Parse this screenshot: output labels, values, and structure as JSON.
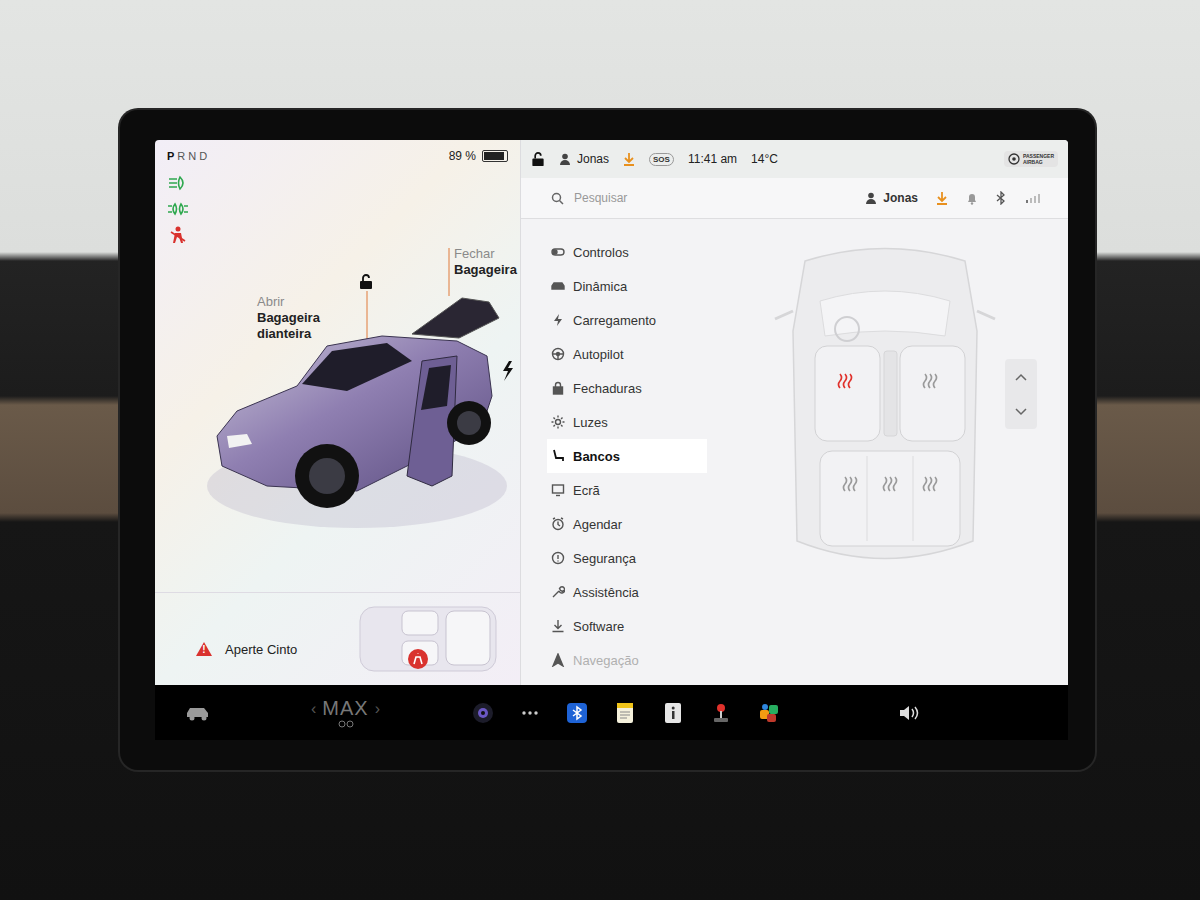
{
  "drive_state": {
    "gears": [
      {
        "label": "P",
        "selected": true
      },
      {
        "label": "R",
        "selected": false
      },
      {
        "label": "N",
        "selected": false
      },
      {
        "label": "D",
        "selected": false
      }
    ],
    "battery": {
      "reading": "89 %",
      "level": 0.89
    }
  },
  "indicators": [
    {
      "kind": "headlight",
      "color": "#2fa84f"
    },
    {
      "kind": "parklight",
      "color": "#2fa84f"
    },
    {
      "kind": "seatbelt",
      "color": "#d9322e"
    }
  ],
  "trunk_controls": [
    {
      "action": "Abrir",
      "target": "Bagageira dianteira",
      "locked": false
    },
    {
      "action": "Fechar",
      "target": "Bagageira"
    }
  ],
  "alert": {
    "icon": "!",
    "text": "Aperte Cinto"
  },
  "status_bar": {
    "locked": false,
    "user": "Jonas",
    "sos": "SOS",
    "time": "11:41 am",
    "temperature": "14°C",
    "badge": {
      "line1": "PASSENGER",
      "line2": "AIRBAG"
    }
  },
  "search": {
    "placeholder": "Pesquisar"
  },
  "profile": {
    "user": "Jonas"
  },
  "menu": [
    {
      "label": "Controlos",
      "kind": "toggle",
      "selected": false
    },
    {
      "label": "Dinâmica",
      "kind": "car",
      "selected": false
    },
    {
      "label": "Carregamento",
      "kind": "bolt",
      "selected": false
    },
    {
      "label": "Autopilot",
      "kind": "wheel",
      "selected": false
    },
    {
      "label": "Fechaduras",
      "kind": "lock",
      "selected": false
    },
    {
      "label": "Luzes",
      "kind": "sun",
      "selected": false
    },
    {
      "label": "Bancos",
      "kind": "seat",
      "selected": true
    },
    {
      "label": "Ecrã",
      "kind": "screen",
      "selected": false
    },
    {
      "label": "Agendar",
      "kind": "clock",
      "selected": false
    },
    {
      "label": "Segurança",
      "kind": "shield",
      "selected": false
    },
    {
      "label": "Assistência",
      "kind": "wrench",
      "selected": false
    },
    {
      "label": "Software",
      "kind": "download",
      "selected": false
    },
    {
      "label": "Navegação",
      "kind": "nav",
      "selected": false
    }
  ],
  "seat_heaters": {
    "front": [
      {
        "on": true
      },
      {
        "on": false
      }
    ],
    "rear": [
      {
        "on": false
      },
      {
        "on": false
      },
      {
        "on": false
      }
    ]
  },
  "dock": {
    "climate": {
      "prev": "‹",
      "label": "MAX",
      "next": "›"
    }
  }
}
